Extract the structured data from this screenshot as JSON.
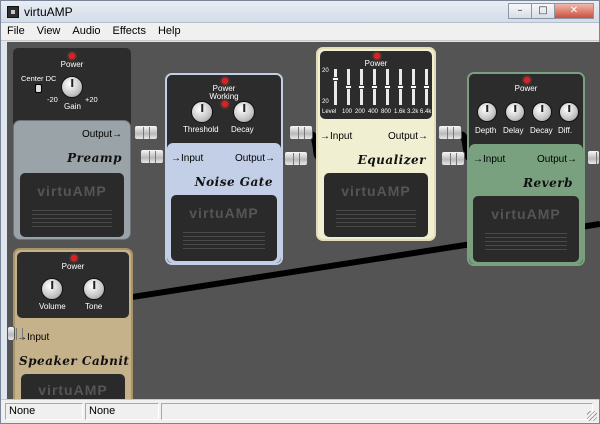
{
  "window": {
    "title": "virtuAMP",
    "minimize": "–",
    "maximize": "□",
    "close": "✕"
  },
  "menu": [
    "File",
    "View",
    "Audio",
    "Effects",
    "Help"
  ],
  "brand": "virtuAMP",
  "pedals": {
    "preamp": {
      "name": "Preamp",
      "power": "Power",
      "toggle_label": "Center DC",
      "gain_label": "Gain",
      "gain_min": "-20",
      "gain_max": "+20",
      "output": "Output→",
      "color": "#9aa3a7"
    },
    "noise_gate": {
      "name": "Noise Gate",
      "power": "Power",
      "working": "Working",
      "threshold": "Threshold",
      "decay": "Decay",
      "input": "→Input",
      "output": "Output→",
      "color": "#c3cfe6"
    },
    "equalizer": {
      "name": "Equalizer",
      "power": "Power",
      "input": "→Input",
      "output": "Output→",
      "color": "#f1efd2",
      "bands": [
        "Level",
        "100",
        "200",
        "400",
        "800",
        "1.6k",
        "3.2k",
        "6.4k"
      ],
      "scale_top": "20",
      "scale_bottom": "20"
    },
    "reverb": {
      "name": "Reverb",
      "power": "Power",
      "depth": "Depth",
      "delay": "Delay",
      "decay": "Decay",
      "diff": "Diff.",
      "input": "→Input",
      "output": "Output→",
      "color": "#7aa17f"
    },
    "speaker_cabinet": {
      "name": "Speaker Cabnit",
      "power": "Power",
      "volume": "Volume",
      "tone": "Tone",
      "input": "→Input",
      "color": "#c6b28a"
    }
  },
  "status": [
    "None",
    "None"
  ],
  "colors": {
    "canvas": "#545454",
    "led": "#e02020"
  }
}
